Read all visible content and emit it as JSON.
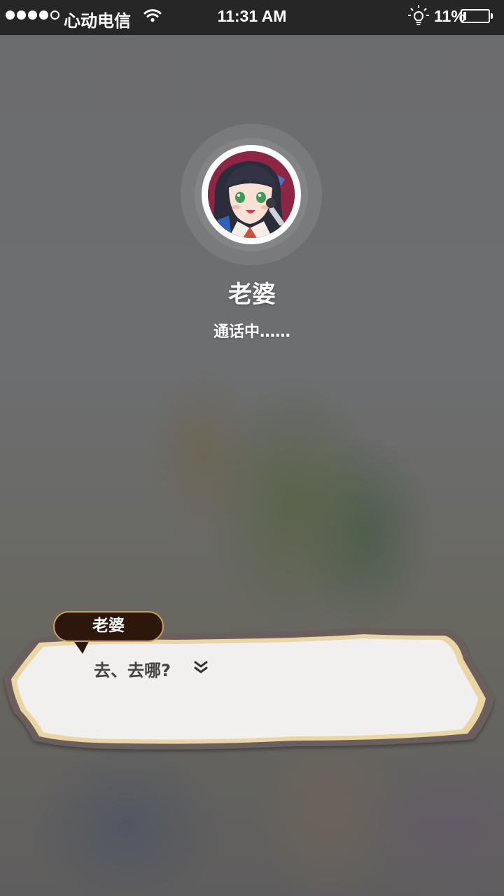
{
  "status_bar": {
    "carrier": "心动电信",
    "time": "11:31 AM",
    "battery_percent": "11%",
    "battery_level": 0.11,
    "signal_bars_filled": 4,
    "signal_bars_total": 5
  },
  "call": {
    "caller_name": "老婆",
    "status": "通话中……"
  },
  "dialogue": {
    "speaker": "老婆",
    "text": "去、去哪?"
  },
  "icons": {
    "wifi": "wifi-icon",
    "bulb": "lightbulb-icon",
    "next": "double-chevron-down-icon"
  },
  "colors": {
    "status_bar_bg": "#262627",
    "speaker_tag_bg": "#2d160b",
    "dialogue_border": "#e9d6a4",
    "dialogue_bg": "#f1f0ef"
  }
}
